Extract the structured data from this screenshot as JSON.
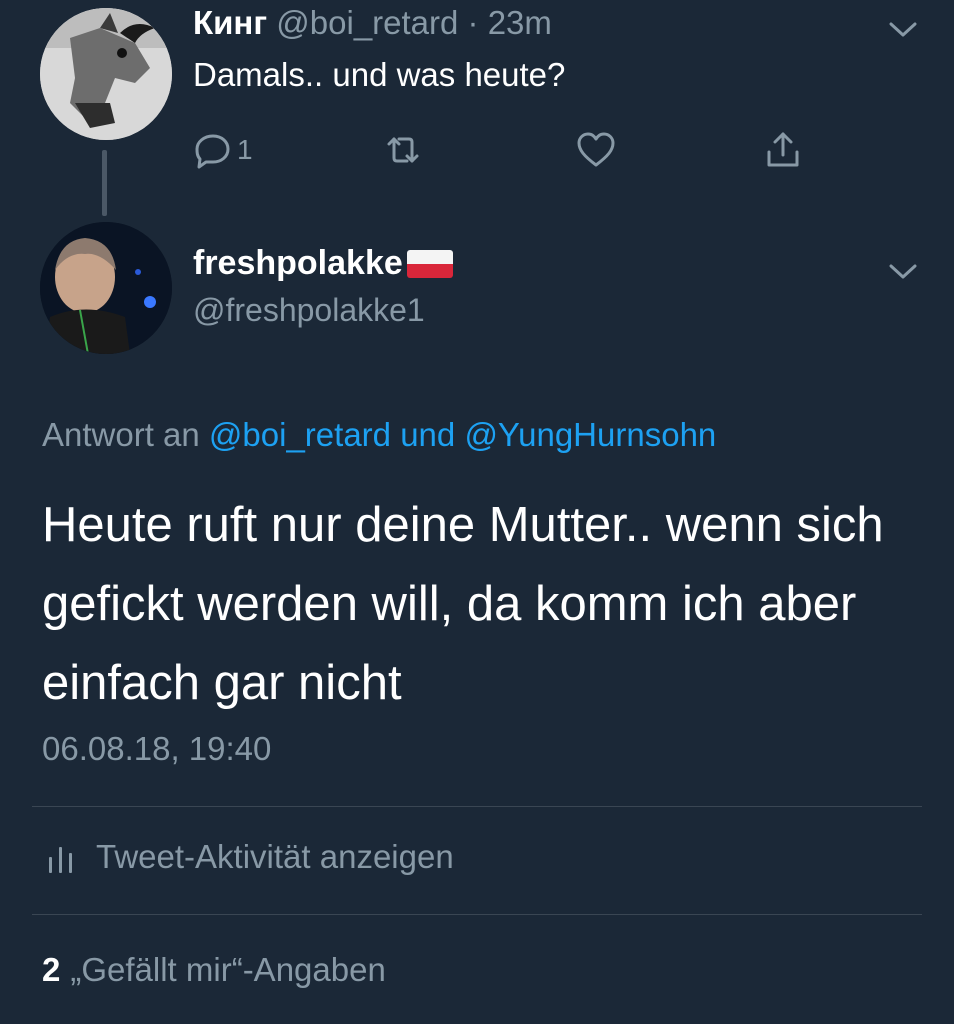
{
  "parent_tweet": {
    "name": "Кинг",
    "handle_time": "@boi_retard · 23m",
    "text": "Damals.. und was heute?",
    "reply_count": "1"
  },
  "main_tweet": {
    "name": "freshpolakke",
    "handle": "@freshpolakke1",
    "reply_prefix": "Antwort an",
    "reply_user1": "@boi_retard",
    "reply_and": "und",
    "reply_user2": "@YungHurnsohn",
    "text": "Heute ruft nur deine Mutter.. wenn sich gefickt werden will, da komm ich aber einfach gar nicht",
    "timestamp": "06.08.18, 19:40"
  },
  "activity": {
    "label": "Tweet-Aktivität anzeigen"
  },
  "likes": {
    "count": "2",
    "label": "„Gefällt mir“-Angaben"
  },
  "icons": [
    "reply-icon",
    "retweet-icon",
    "like-icon",
    "share-icon",
    "chevron-down-icon",
    "activity-chart-icon",
    "poland-flag-icon"
  ],
  "colors": {
    "background": "#1b2837",
    "muted_text": "#8899a6",
    "link": "#1da1f2",
    "divider": "#3a4653"
  }
}
